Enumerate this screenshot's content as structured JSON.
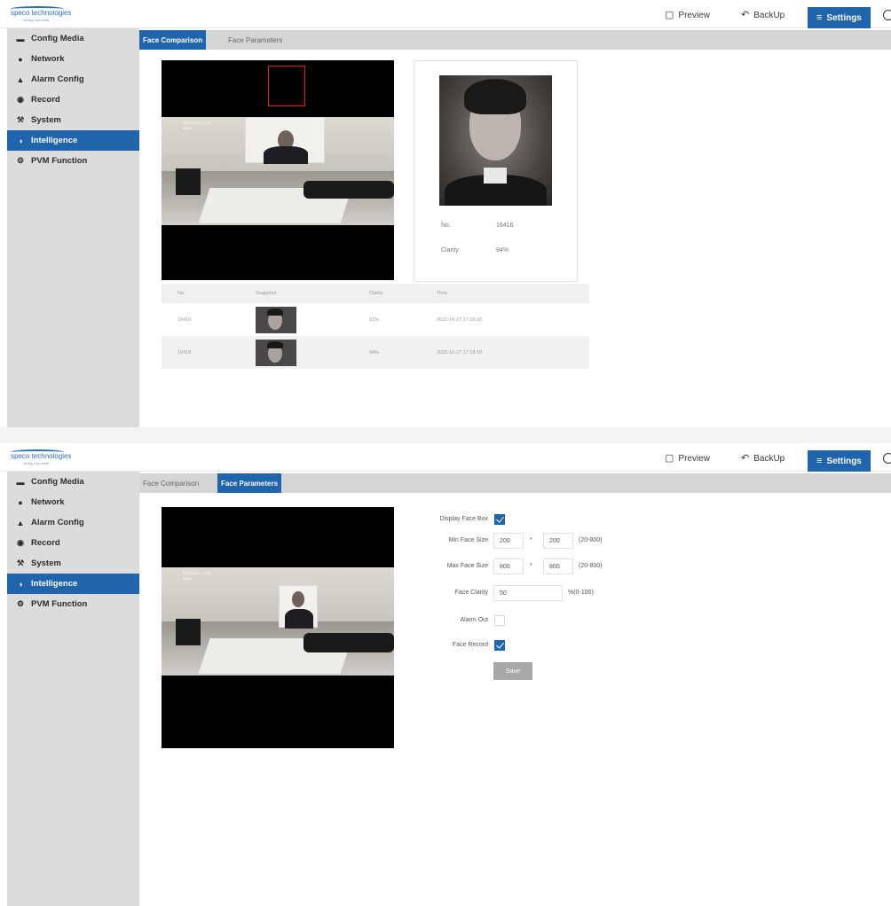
{
  "brand": {
    "name": "speco technologies",
    "tagline": "Giving You More"
  },
  "nav": {
    "preview": "Preview",
    "backup": "BackUp",
    "settings": "Settings"
  },
  "sidebar": {
    "items": [
      {
        "label": "Config Media",
        "icon": "folder-icon"
      },
      {
        "label": "Network",
        "icon": "globe-icon"
      },
      {
        "label": "Alarm Config",
        "icon": "bell-icon"
      },
      {
        "label": "Record",
        "icon": "record-icon"
      },
      {
        "label": "System",
        "icon": "wrench-icon"
      },
      {
        "label": "Intelligence",
        "icon": "intelligence-icon",
        "active": true
      },
      {
        "label": "PVM Function",
        "icon": "gear-icon"
      }
    ]
  },
  "tabs": {
    "face_comparison": "Face Comparison",
    "face_parameters": "Face Parameters"
  },
  "comparison": {
    "match": {
      "no_label": "No.",
      "no_value": "16416",
      "clarity_label": "Clarity",
      "clarity_value": "94%"
    },
    "table": {
      "headers": [
        "No.",
        "Snapshot",
        "Clarity",
        "Time"
      ],
      "rows": [
        {
          "no": "16416",
          "clarity": "91%",
          "time": "2022-10-27 17:18:18"
        },
        {
          "no": "16418",
          "clarity": "94%",
          "time": "2022-10-27 17:18:18"
        }
      ]
    }
  },
  "parameters": {
    "display_face_box_label": "Display Face Box",
    "display_face_box": true,
    "min_face_size_label": "Min Face Size",
    "min_face_w": "200",
    "min_face_h": "200",
    "min_face_range": "(20-800)",
    "max_face_size_label": "Max Face Size",
    "max_face_w": "800",
    "max_face_h": "800",
    "max_face_range": "(20-800)",
    "face_clarity_label": "Face Clarity",
    "face_clarity": "50",
    "face_clarity_range": "%(0-100)",
    "alarm_out_label": "Alarm Out",
    "alarm_out": false,
    "face_record_label": "Face Record",
    "face_record": true,
    "separator": "*",
    "save_label": "Save"
  },
  "video": {
    "osd_time": "2022-10-27 17:18",
    "osd_fps": "25fps"
  },
  "colors": {
    "accent": "#1f64ad",
    "sidebar": "#dcdcdc",
    "tabbar": "#d5d5d5"
  }
}
